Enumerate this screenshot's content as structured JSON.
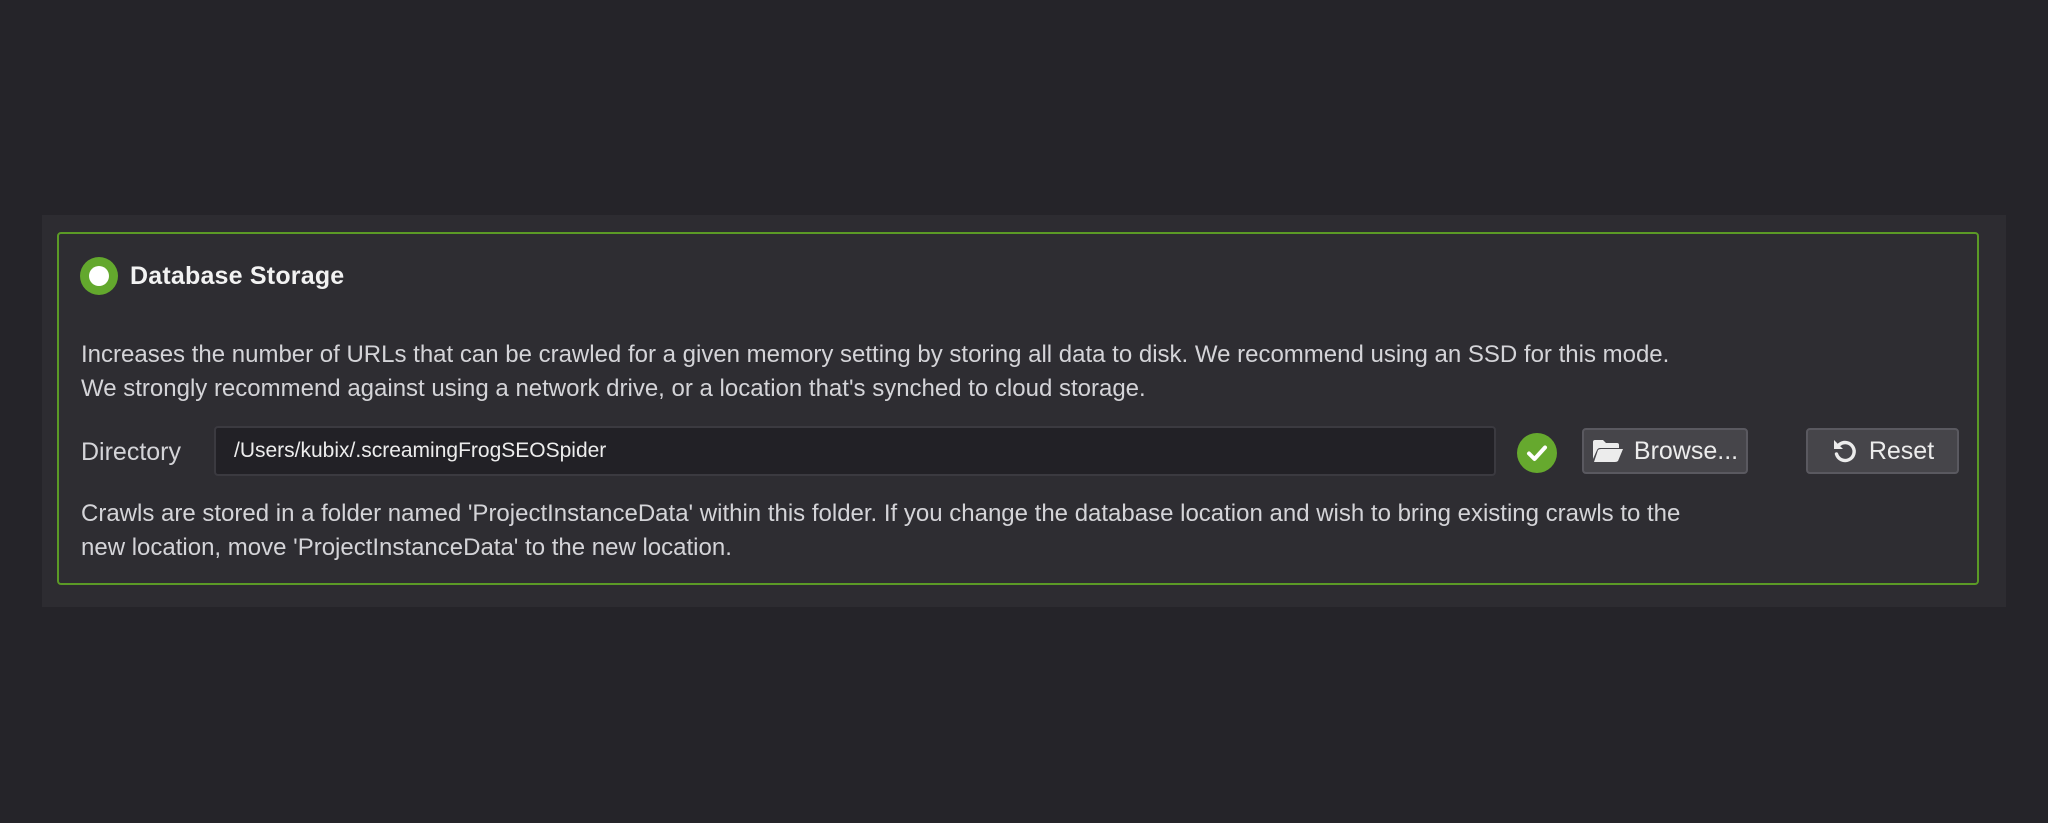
{
  "storage_option": {
    "label": "Database Storage",
    "selected": true,
    "accent_color": "#63a82d"
  },
  "description": {
    "line1": "Increases the number of URLs that can be crawled for a given memory setting by storing all data to disk. We recommend using an SSD for this mode.",
    "line2": "We strongly recommend against using a network drive, or a location that's synched to cloud storage."
  },
  "directory": {
    "label": "Directory",
    "value": "/Users/kubix/.screamingFrogSEOSpider",
    "status_icon": "check-circle-icon"
  },
  "buttons": {
    "browse_label": "Browse...",
    "browse_icon": "folder-open-icon",
    "reset_label": "Reset",
    "reset_icon": "undo-icon"
  },
  "note": {
    "line1": "Crawls are stored in a folder named 'ProjectInstanceData' within this folder. If you change the database location and wish to bring existing crawls to the",
    "line2": "new location, move 'ProjectInstanceData' to the new location."
  }
}
